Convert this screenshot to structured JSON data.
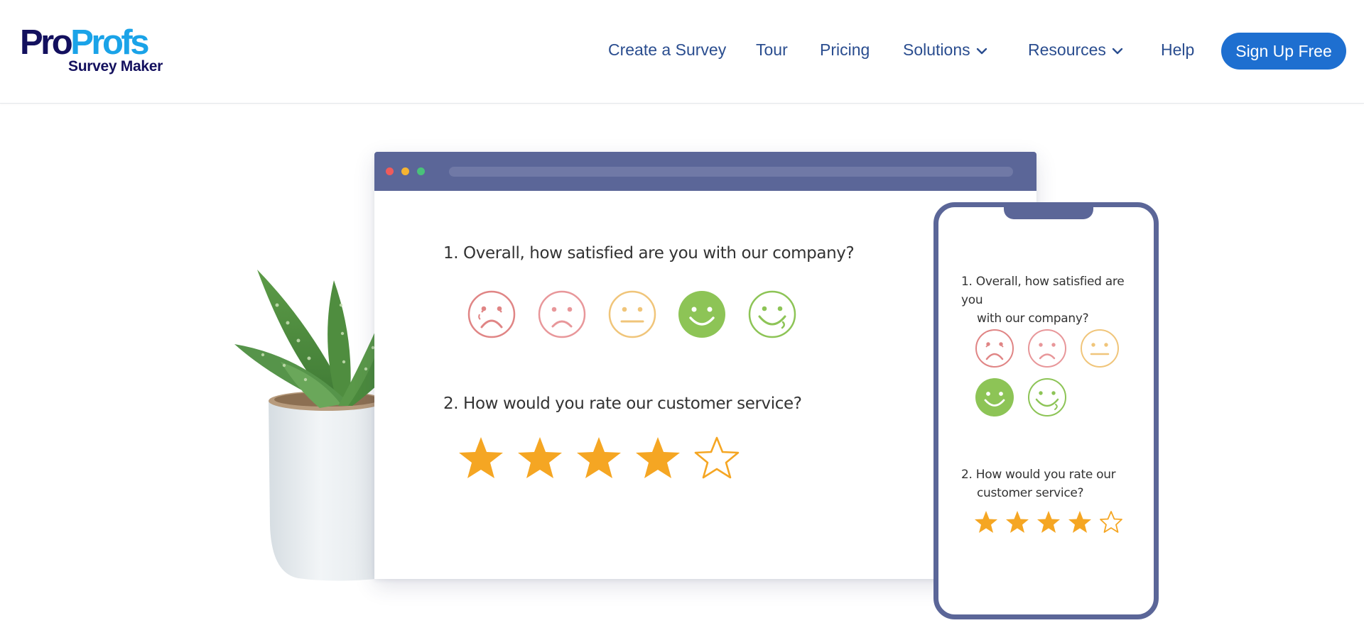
{
  "header": {
    "logo": {
      "pro": "Pro",
      "profs": "Profs",
      "product": "Survey Maker"
    },
    "nav": [
      {
        "label": "Create a Survey",
        "has_dropdown": false
      },
      {
        "label": "Tour",
        "has_dropdown": false
      },
      {
        "label": "Pricing",
        "has_dropdown": false
      },
      {
        "label": "Solutions",
        "has_dropdown": true
      },
      {
        "label": "Resources",
        "has_dropdown": true
      },
      {
        "label": "Help",
        "has_dropdown": false
      }
    ],
    "cta_label": "Sign Up Free"
  },
  "colors": {
    "brand_dark": "#13105e",
    "brand_light": "#1aa3e8",
    "nav_text": "#2a4d8f",
    "cta": "#1e6fd0",
    "frame": "#5b6698",
    "star": "#f5a623",
    "face_red": "#e08585",
    "face_yellow": "#f0c57a",
    "face_green": "#8dc456"
  },
  "desktop_survey": {
    "question_1": "1. Overall, how satisfied are you with our company?",
    "question_2": "2. How would you rate our customer service?",
    "faces": [
      "very-dissatisfied-face-icon",
      "dissatisfied-face-icon",
      "neutral-face-icon",
      "satisfied-face-icon",
      "very-satisfied-face-icon"
    ],
    "selected_face": 3,
    "rating": 4,
    "rating_max": 5
  },
  "mobile_survey": {
    "question_1_num": "1.",
    "question_1_a": "Overall, how satisfied are you",
    "question_1_b": "with our company?",
    "question_2_num": "2.",
    "question_2_a": "How would you rate our",
    "question_2_b": "customer service?",
    "selected_face": 3,
    "rating": 4,
    "rating_max": 5
  }
}
